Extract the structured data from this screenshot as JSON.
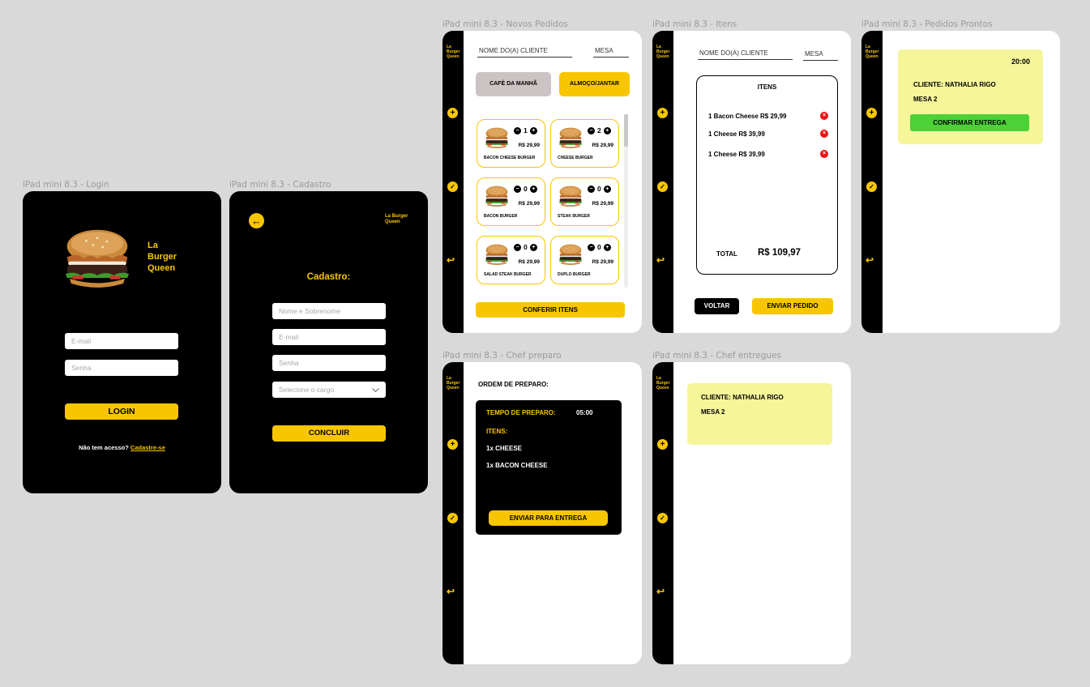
{
  "frames": {
    "login": "iPad mini 8.3 - Login",
    "cadastro": "iPad mini 8.3 - Cadastro",
    "novos": "iPad mini 8.3 - Novos Pedidos",
    "itens": "iPad mini 8.3 - Itens",
    "prontos": "iPad mini 8.3 - Pedidos Prontos",
    "chef_preparo": "iPad mini 8.3 - Chef preparo",
    "chef_entregues": "iPad mini 8.3 - Chef entregues"
  },
  "brand": {
    "line1": "La",
    "line2": "Burger",
    "line3": "Queen",
    "short": "La Burger Queen"
  },
  "login": {
    "email_placeholder": "E-mail",
    "senha_placeholder": "Senha",
    "button": "LOGIN",
    "no_access": "Não  tem acesso?",
    "signup_link": "Cadastre-se"
  },
  "cadastro": {
    "title": "Cadastro:",
    "nome_placeholder": "Nome e Sobrenome",
    "email_placeholder": "E-mail",
    "senha_placeholder": "Senha",
    "cargo_placeholder": "Selecione o cargo",
    "button": "CONCLUIR"
  },
  "sidebar_icons": [
    "plus-icon",
    "check-icon",
    "logout-icon"
  ],
  "novos": {
    "cliente_label": "NOME DO(A) CLIENTE",
    "mesa_label": "MESA",
    "tab_cafe": "CAFÉ DA MANHÃ",
    "tab_almoco": "ALMOÇO/JANTAR",
    "products": [
      {
        "name": "BACON CHEESE BURGER",
        "qty": "1",
        "price": "R$ 29,99"
      },
      {
        "name": "CHEESE BURGER",
        "qty": "2",
        "price": "R$ 29,99"
      },
      {
        "name": "BACON BURGER",
        "qty": "0",
        "price": "R$ 29,99"
      },
      {
        "name": "STEAK BURGER",
        "qty": "0",
        "price": "R$ 29,99"
      },
      {
        "name": "SALAD STEAK BURGER",
        "qty": "0",
        "price": "R$ 29,99"
      },
      {
        "name": "DUPLO BURGER",
        "qty": "0",
        "price": "R$ 29,99"
      }
    ],
    "button": "CONFERIR ITENS"
  },
  "itens": {
    "cliente_label": "NOME DO(A) CLIENTE",
    "mesa_label": "MESA",
    "title": "ITENS",
    "rows": [
      "1 Bacon Cheese  R$ 29,99",
      "1 Cheese  R$ 39,99",
      "1 Cheese  R$ 39,99"
    ],
    "total_label": "TOTAL",
    "total_value": "R$ 109,97",
    "back": "VOLTAR",
    "send": "ENVIAR PEDIDO"
  },
  "prontos": {
    "time": "20:00",
    "cliente": "CLIENTE: NATHALIA RIGO",
    "mesa": "MESA 2",
    "button": "CONFIRMAR ENTREGA"
  },
  "chef_preparo": {
    "title": "ORDEM DE PREPARO:",
    "tempo_label": "TEMPO DE PREPARO:",
    "tempo_value": "05:00",
    "itens_label": "ITENS:",
    "items": [
      "1x CHEESE",
      "1x BACON CHEESE"
    ],
    "button": "ENVIAR PARA ENTREGA"
  },
  "chef_entregues": {
    "cliente": "CLIENTE: NATHALIA RIGO",
    "mesa": "MESA 2"
  },
  "colors": {
    "accent": "#f7c600",
    "ready_card": "#f5f59a",
    "confirm_green": "#4cd137",
    "remove_red": "#e11111"
  }
}
